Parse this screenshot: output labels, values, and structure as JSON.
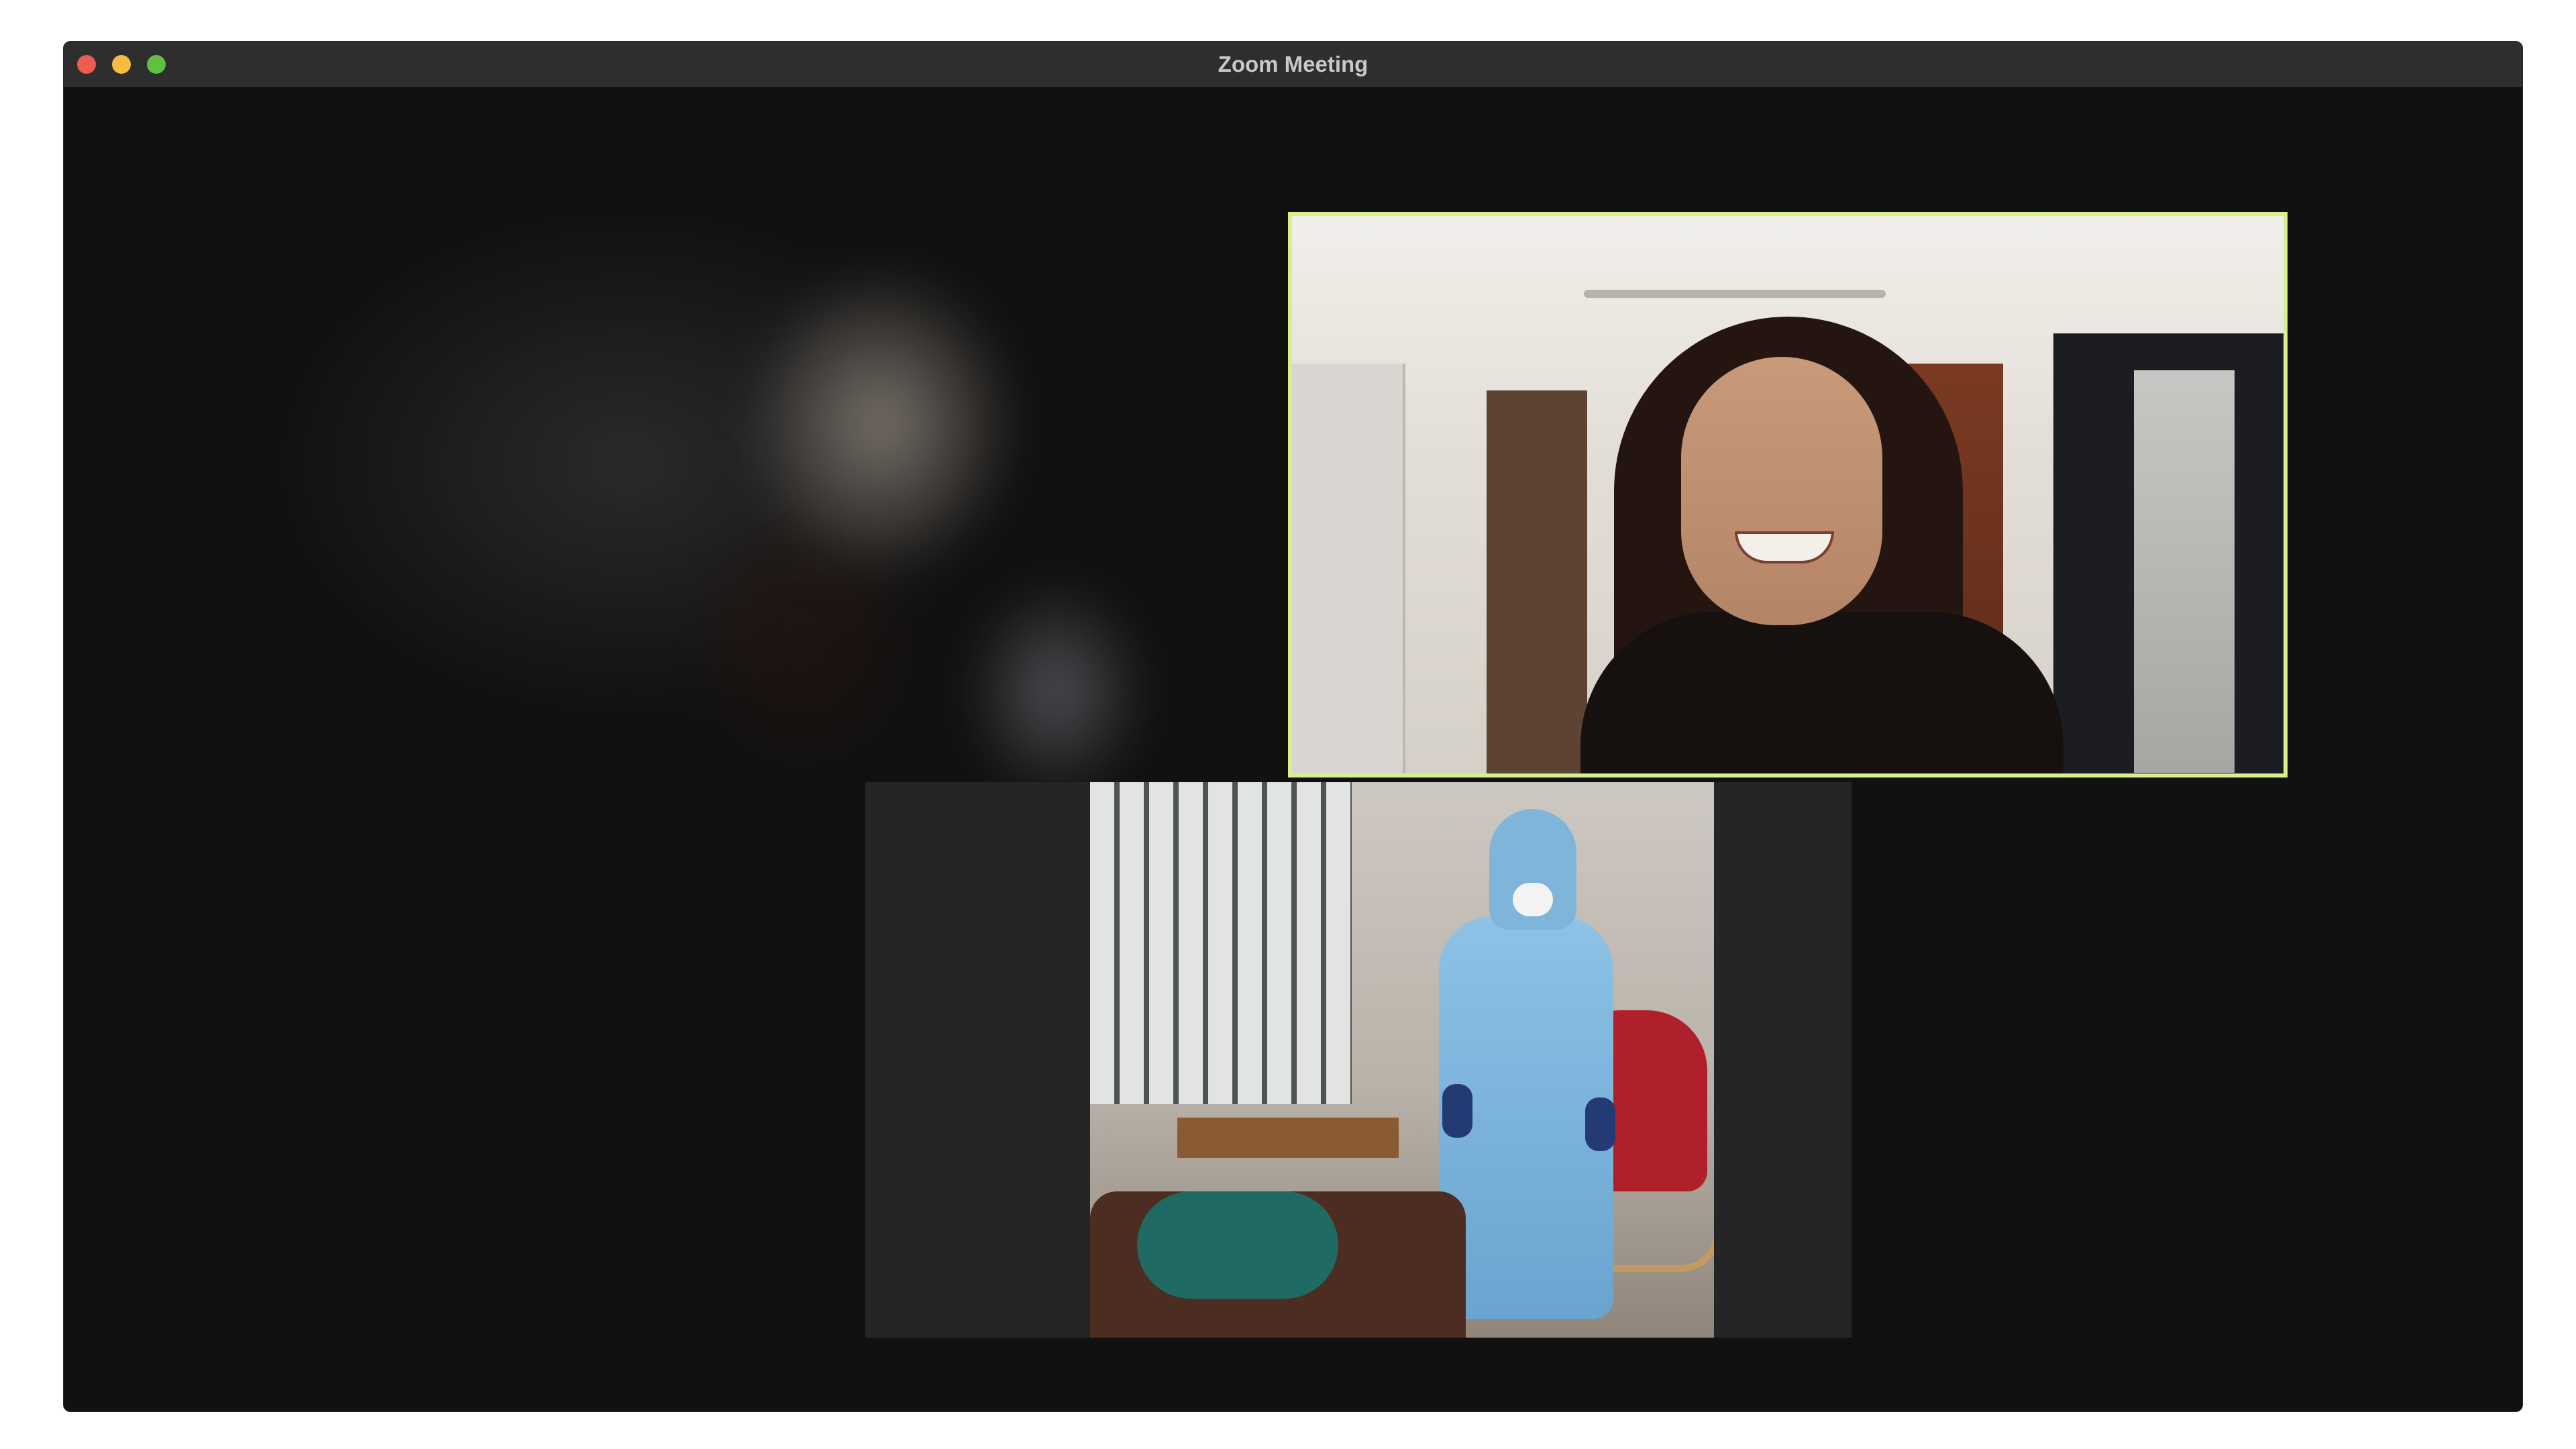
{
  "window": {
    "title": "Zoom Meeting"
  },
  "participants": [
    {
      "role": "background",
      "blurred": true
    },
    {
      "role": "active-speaker",
      "highlight_color": "#d8f08b"
    },
    {
      "role": "participant"
    }
  ],
  "colors": {
    "background": "#111111",
    "tile": "#232323",
    "active_border": "#d8f08b",
    "traffic_close": "#ed5b52",
    "traffic_minimize": "#f5bd3d",
    "traffic_maximize": "#5fc13f"
  }
}
